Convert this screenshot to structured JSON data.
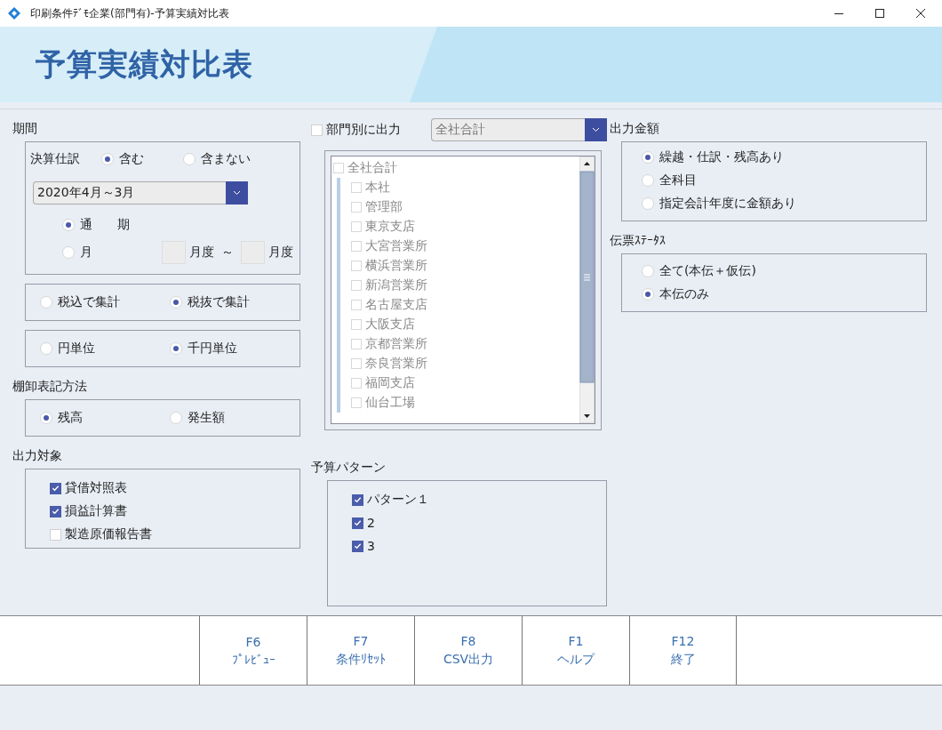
{
  "window": {
    "title": "印刷条件ﾃﾞﾓ企業(部門有)-予算実績対比表"
  },
  "header": {
    "title": "予算実績対比表"
  },
  "period": {
    "label": "期間",
    "closing_label": "決算仕訳",
    "closing_options": [
      {
        "label": "含む",
        "selected": true
      },
      {
        "label": "含まない",
        "selected": false
      }
    ],
    "fiscal_year": "2020年4月～3月",
    "full_option": {
      "label": "通　　期",
      "selected": true
    },
    "month_option": {
      "label": "月",
      "selected": false
    },
    "month_unit_from": "月度",
    "range_sep": "～",
    "month_unit_to": "月度"
  },
  "tax_options": [
    {
      "label": "税込で集計",
      "selected": false
    },
    {
      "label": "税抜で集計",
      "selected": true
    }
  ],
  "unit_options": [
    {
      "label": "円単位",
      "selected": false
    },
    {
      "label": "千円単位",
      "selected": true
    }
  ],
  "inventory": {
    "label": "棚卸表記方法",
    "options": [
      {
        "label": "残高",
        "selected": true
      },
      {
        "label": "発生額",
        "selected": false
      }
    ]
  },
  "output_target": {
    "label": "出力対象",
    "items": [
      {
        "label": "貸借対照表",
        "checked": true
      },
      {
        "label": "損益計算書",
        "checked": true
      },
      {
        "label": "製造原価報告書",
        "checked": false
      }
    ]
  },
  "department": {
    "label": "部門別に出力",
    "checked": false,
    "dropdown": "全社合計",
    "disabled": true
  },
  "department_tree": {
    "disabled": true,
    "root": {
      "label": "全社合計",
      "checked": false,
      "children": [
        {
          "label": "本社",
          "checked": false
        },
        {
          "label": "管理部",
          "checked": false
        },
        {
          "label": "東京支店",
          "checked": false
        },
        {
          "label": "大宮営業所",
          "checked": false
        },
        {
          "label": "横浜営業所",
          "checked": false
        },
        {
          "label": "新潟営業所",
          "checked": false
        },
        {
          "label": "名古屋支店",
          "checked": false
        },
        {
          "label": "大阪支店",
          "checked": false
        },
        {
          "label": "京都営業所",
          "checked": false
        },
        {
          "label": "奈良営業所",
          "checked": false
        },
        {
          "label": "福岡支店",
          "checked": false
        },
        {
          "label": "仙台工場",
          "checked": false
        }
      ]
    }
  },
  "budget_pattern": {
    "label": "予算パターン",
    "items": [
      {
        "label": "パターン１",
        "checked": true
      },
      {
        "label": "2",
        "checked": true
      },
      {
        "label": "3",
        "checked": true
      }
    ]
  },
  "output_amount": {
    "label": "出力金額",
    "options": [
      {
        "label": "繰越・仕訳・残高あり",
        "selected": true
      },
      {
        "label": "全科目",
        "selected": false
      },
      {
        "label": "指定会計年度に金額あり",
        "selected": false
      }
    ]
  },
  "voucher_status": {
    "label": "伝票ｽﾃｰﾀｽ",
    "options": [
      {
        "label": "全て(本伝＋仮伝)",
        "selected": false
      },
      {
        "label": "本伝のみ",
        "selected": true
      }
    ]
  },
  "function_keys": [
    {
      "key": "F6",
      "label": "ﾌﾟﾚﾋﾞｭｰ"
    },
    {
      "key": "F7",
      "label": "条件ﾘｾｯﾄ"
    },
    {
      "key": "F8",
      "label": "CSV出力"
    },
    {
      "key": "F1",
      "label": "ヘルプ"
    },
    {
      "key": "F12",
      "label": "終了"
    }
  ]
}
